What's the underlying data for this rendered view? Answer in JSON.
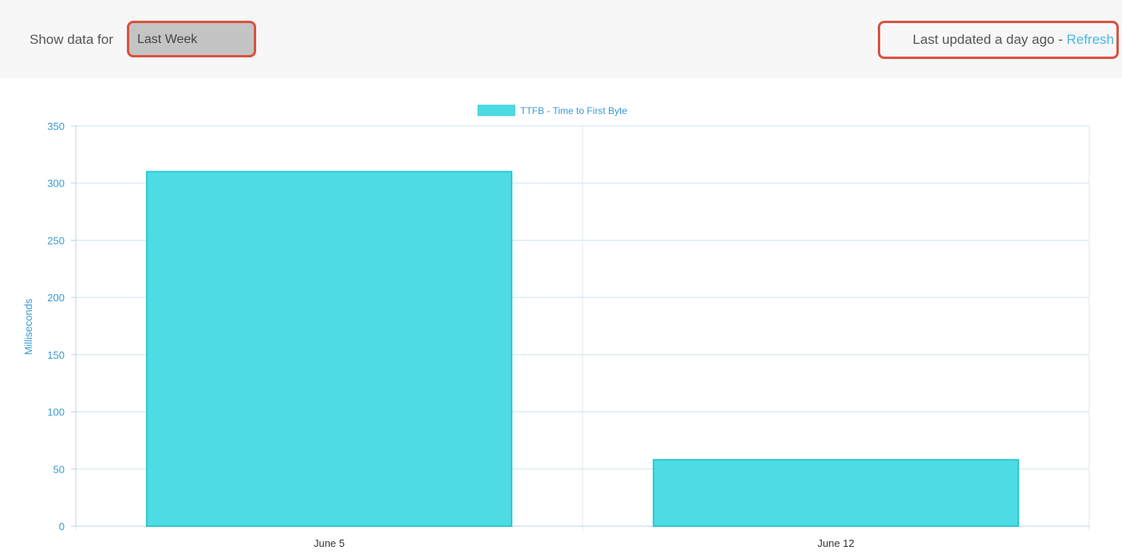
{
  "filter": {
    "show_label": "Show data for",
    "range_value": "Last Week"
  },
  "status": {
    "updated_text": "Last updated a day ago - ",
    "refresh_label": "Refresh"
  },
  "colors": {
    "bar_fill": "#4ddbe4",
    "bar_stroke": "#2ec8d2",
    "highlight": "#d9533f",
    "link": "#48b6e8"
  },
  "chart_data": {
    "type": "bar",
    "categories": [
      "June 5",
      "June 12"
    ],
    "series": [
      {
        "name": "TTFB - Time to First Byte",
        "values": [
          310,
          58
        ]
      }
    ],
    "ylabel": "Milliseconds",
    "ylim": [
      0,
      350
    ],
    "yticks": [
      0,
      50,
      100,
      150,
      200,
      250,
      300,
      350
    ],
    "grid": true,
    "legend": "top-center"
  }
}
